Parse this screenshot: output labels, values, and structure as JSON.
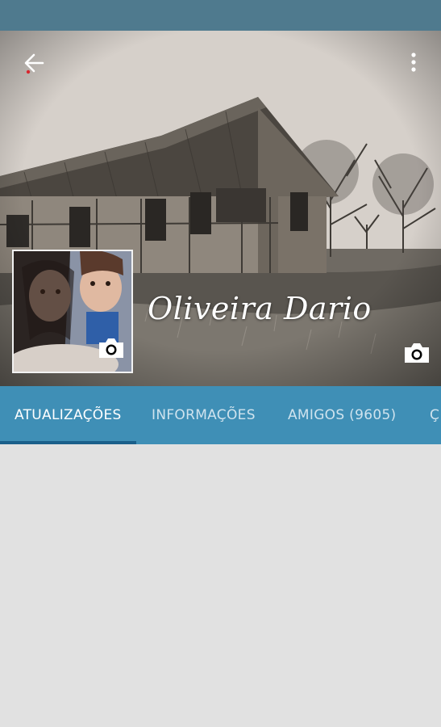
{
  "profile": {
    "name": "Oliveira Dario"
  },
  "icons": {
    "back": "arrow-left-icon",
    "more": "more-vertical-icon",
    "camera": "camera-icon"
  },
  "colors": {
    "status_bar": "#4f7a8e",
    "tab_bar": "#3f8fb6",
    "tab_indicator": "#1a5f8a",
    "background": "#e1e1e1"
  },
  "tabs": [
    {
      "label": "ATUALIZAÇÕES",
      "active": true
    },
    {
      "label": "INFORMAÇÕES",
      "active": false
    },
    {
      "label": "AMIGOS (9605)",
      "active": false
    },
    {
      "label": "Ç",
      "active": false
    }
  ]
}
